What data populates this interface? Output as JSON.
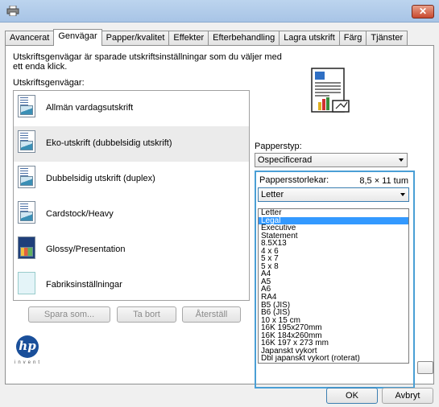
{
  "window": {
    "close_label": "✕"
  },
  "tabs": [
    {
      "label": "Avancerat"
    },
    {
      "label": "Genvägar"
    },
    {
      "label": "Papper/kvalitet"
    },
    {
      "label": "Effekter"
    },
    {
      "label": "Efterbehandling"
    },
    {
      "label": "Lagra utskrift"
    },
    {
      "label": "Färg"
    },
    {
      "label": "Tjänster"
    }
  ],
  "shortcuts": {
    "description": "Utskriftsgenvägar är sparade utskriftsinställningar som du väljer med ett enda klick.",
    "list_label": "Utskriftsgenvägar:",
    "items": [
      {
        "label": "Allmän vardagsutskrift"
      },
      {
        "label": "Eko-utskrift (dubbelsidig utskrift)"
      },
      {
        "label": "Dubbelsidig utskrift (duplex)"
      },
      {
        "label": "Cardstock/Heavy"
      },
      {
        "label": "Glossy/Presentation"
      },
      {
        "label": "Fabriksinställningar"
      }
    ],
    "save_as": "Spara som...",
    "delete": "Ta bort",
    "restore": "Återställ"
  },
  "paper_type": {
    "label": "Papperstyp:",
    "value": "Ospecificerad"
  },
  "paper_size": {
    "label": "Pappersstorlekar:",
    "dimensions": "8,5 × 11 tum",
    "value": "Letter",
    "options": [
      "Letter",
      "Legal",
      "Executive",
      "Statement",
      "8.5X13",
      "4 x 6",
      "5 x 7",
      "5 x 8",
      "A4",
      "A5",
      "A6",
      "RA4",
      "B5 (JIS)",
      "B6 (JIS)",
      "10 x 15 cm",
      "16K 195x270mm",
      "16K 184x260mm",
      "16K 197 x 273 mm",
      "Japanskt vykort",
      "Dbl japanskt vykort (roterat)"
    ],
    "highlighted_option": "Legal"
  },
  "logo": {
    "text": "hp",
    "tagline": "invent"
  },
  "footer": {
    "ok": "OK",
    "cancel": "Avbryt"
  },
  "colors": {
    "accent": "#3399ff",
    "highlight_border": "#4a9fd5"
  }
}
